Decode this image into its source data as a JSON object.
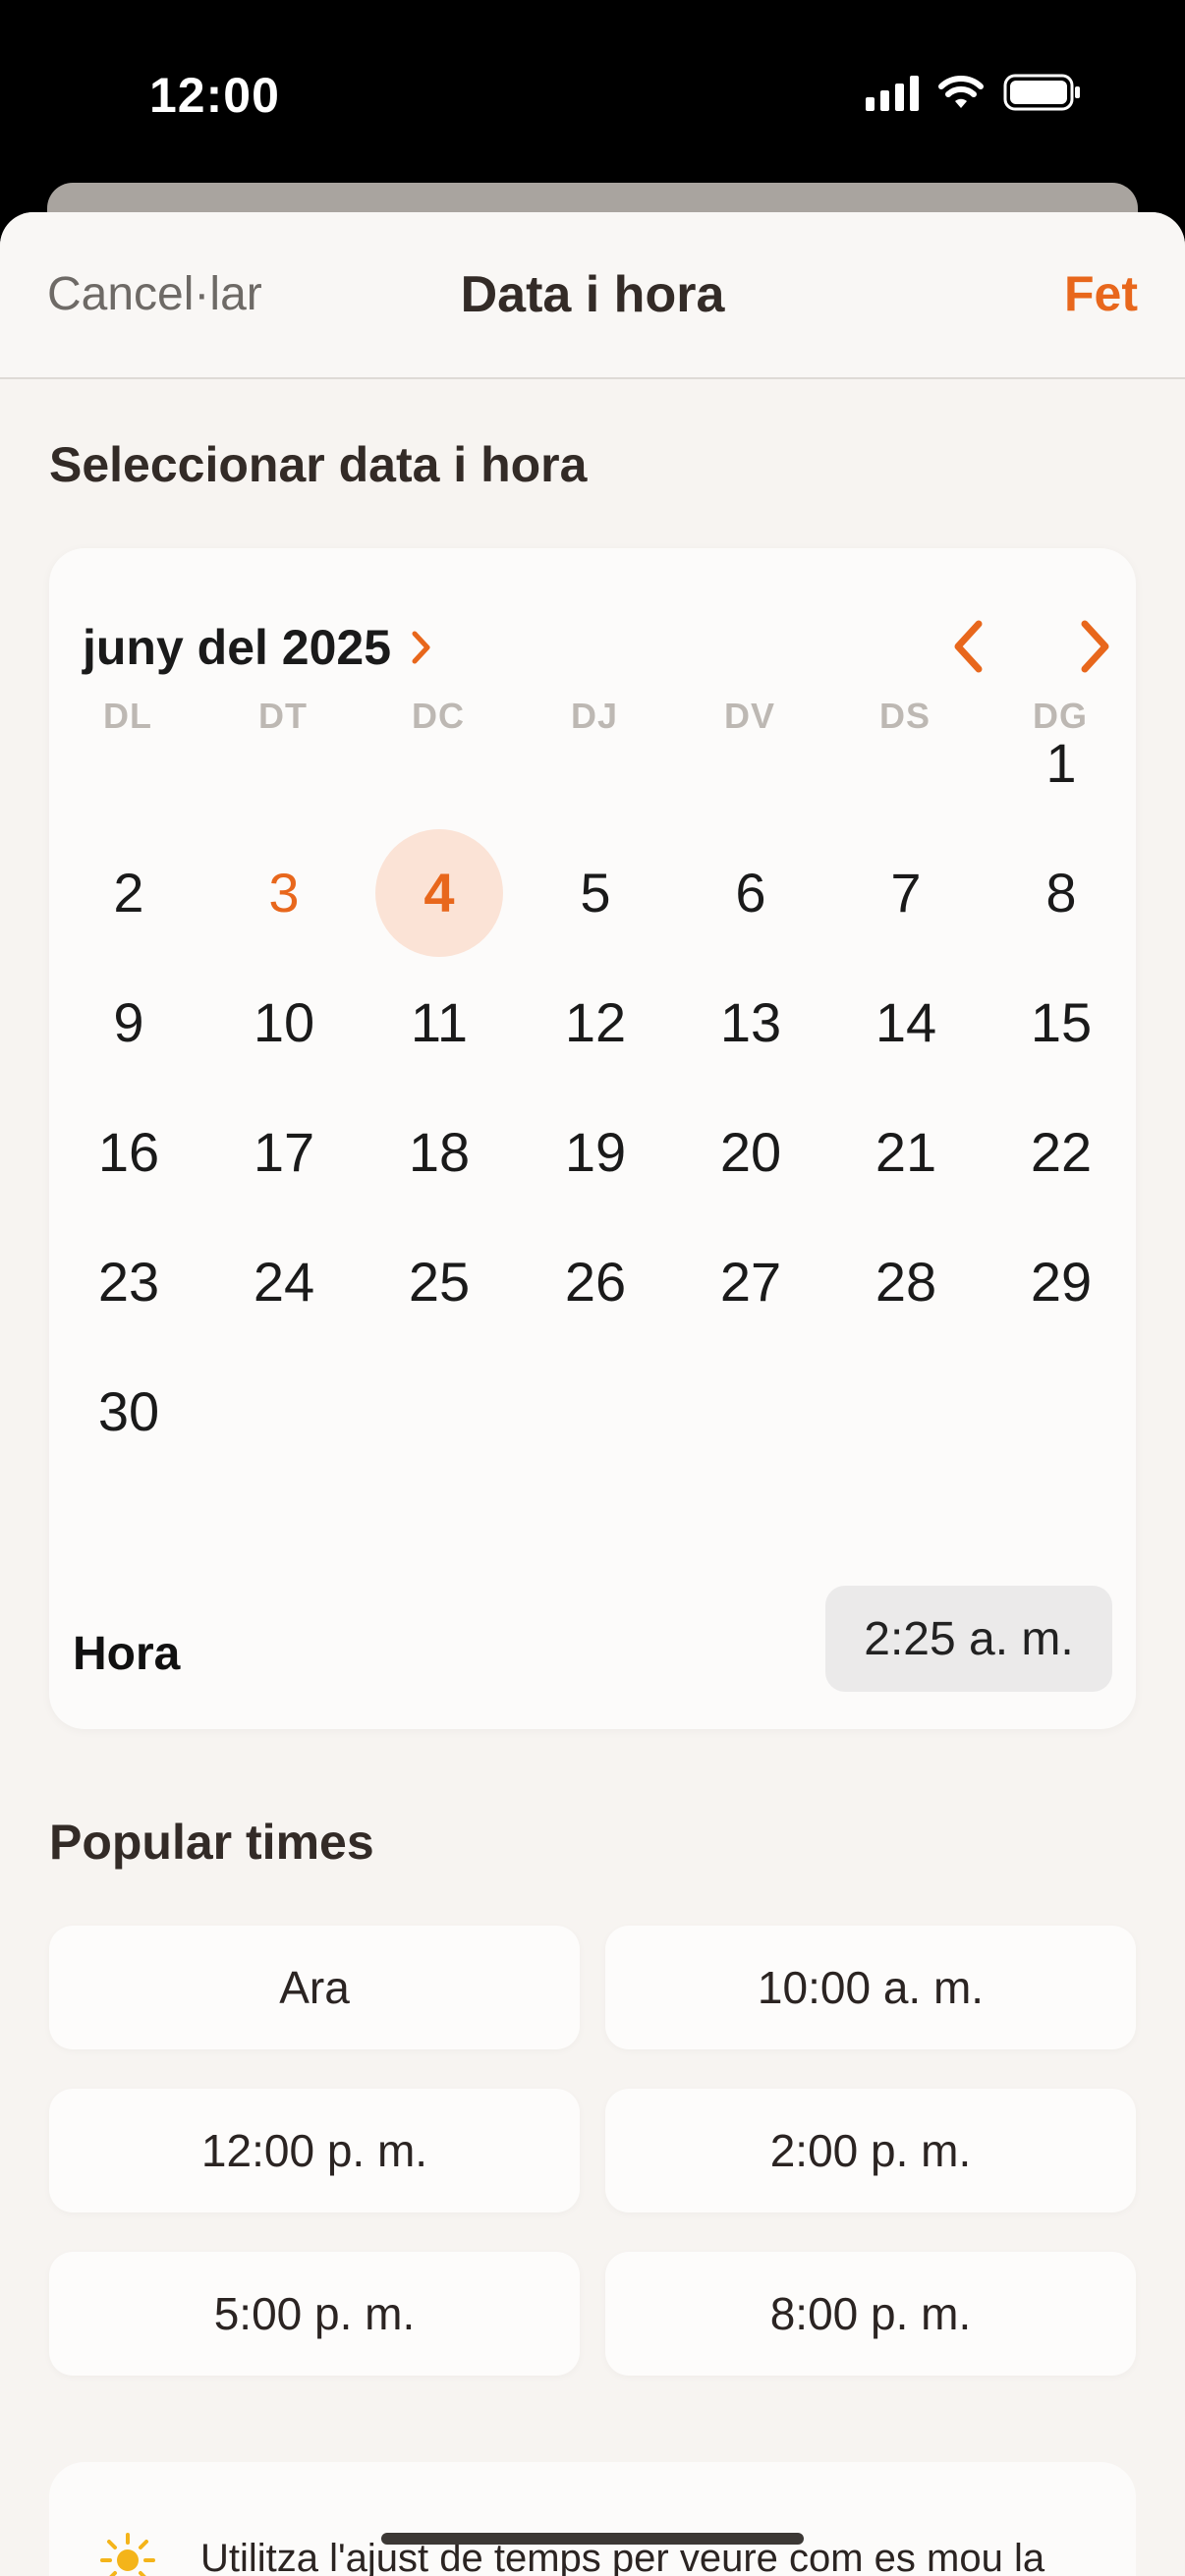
{
  "status_bar": {
    "time": "12:00"
  },
  "nav": {
    "cancel": "Cancel·lar",
    "title": "Data i hora",
    "done": "Fet"
  },
  "section_select": "Seleccionar data i hora",
  "calendar": {
    "month_label": "juny del 2025",
    "weekdays": [
      "DL",
      "DT",
      "DC",
      "DJ",
      "DV",
      "DS",
      "DG"
    ],
    "days": [
      "1",
      "2",
      "3",
      "4",
      "5",
      "6",
      "7",
      "8",
      "9",
      "10",
      "11",
      "12",
      "13",
      "14",
      "15",
      "16",
      "17",
      "18",
      "19",
      "20",
      "21",
      "22",
      "23",
      "24",
      "25",
      "26",
      "27",
      "28",
      "29",
      "30"
    ],
    "today": "3",
    "selected": "4",
    "hour_label": "Hora",
    "time_value": "2:25 a. m."
  },
  "section_popular": "Popular times",
  "popular_times": [
    "Ara",
    "10:00 a. m.",
    "12:00 p. m.",
    "2:00 p. m.",
    "5:00 p. m.",
    "8:00 p. m."
  ],
  "tip": {
    "text": "Utilitza l'ajust de temps per veure com es mou la llum solar durant el dia."
  },
  "colors": {
    "accent": "#e8671c",
    "selected_bg": "#fbe3d6",
    "background": "#f7f4f1"
  }
}
